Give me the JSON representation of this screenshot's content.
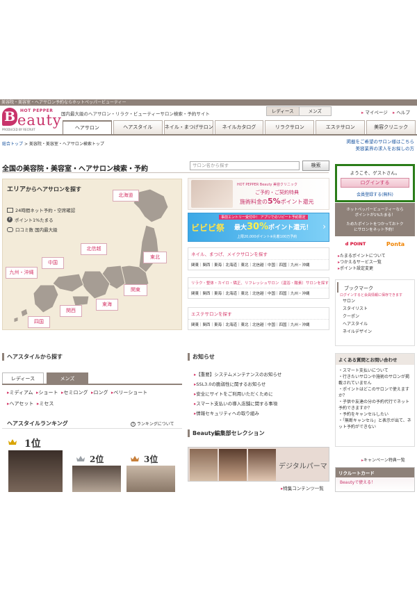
{
  "topbar": {
    "text": "美容院・美容室・ヘアサロン予約ならホットペッパービューティー"
  },
  "logo": {
    "hot_pepper": "HOT PEPPER",
    "b": "B",
    "word": "eauty",
    "by": "PRODUCED BY RECRUIT"
  },
  "header": {
    "tagline": "国内最大級のヘアサロン・リラク・ビューティーサロン検索・予約サイト",
    "gender_tabs": [
      "レディース",
      "メンズ"
    ],
    "mypage": "マイページ",
    "help": "ヘルプ"
  },
  "nav": {
    "tabs": [
      "ヘアサロン",
      "ヘアスタイル",
      "ネイル・まつげサロン",
      "ネイルカタログ",
      "リラクサロン",
      "エステサロン",
      "美容クリニック"
    ]
  },
  "breadcrumb": {
    "home": "総合トップ",
    "sep": ">",
    "current": "美容院・美容室・ヘアサロン検索トップ"
  },
  "recruit": {
    "line1": "掲載をご希望のサロン様はこちら",
    "line2": "美容業界の求人をお探しの方"
  },
  "main": {
    "title": "全国の美容院・美容室・ヘアサロン検索・予約",
    "search_placeholder": "サロン名から探す",
    "search_button": "検索"
  },
  "map": {
    "heading_area": "エリア",
    "heading_rest": "からヘアサロンを探す",
    "features": [
      "24時間ネット予約・空席確認",
      "ポイント1%たまる",
      "口コミ数 国内最大級"
    ],
    "regions": [
      "北海道",
      "東北",
      "北信越",
      "関東",
      "中国",
      "九州・沖縄",
      "関西",
      "東海",
      "四国"
    ]
  },
  "banners": {
    "clinic_brand": "HOT PEPPER Beauty 美容クリニック",
    "clinic_line1": "ご予約・ご契約特典",
    "clinic_line2a": "施術料金の",
    "clinic_percent": "5%",
    "clinic_line2b": "ポイント還元",
    "app_top": "事前エントリー受付中！ アプリでのリピート予約限定",
    "app_fes": "ビビビ祭",
    "app_mid_a": "最大",
    "app_mid_percent": "30%",
    "app_mid_b": "ポイント還元！",
    "app_bottom": "上限20,000ポイント※先着100万予約"
  },
  "categories": [
    {
      "title": "ネイル、まつげ、メイクサロンを探す",
      "links": "関東｜関西｜東海｜北海道｜東北｜北信越｜中国｜四国｜九州・沖縄"
    },
    {
      "title": "リラク・整体・カイロ・矯正、リフレッシュサロン（温浴・酸素）サロンを探す",
      "links": "関東｜関西｜東海｜北海道｜東北｜北信越｜中国｜四国｜九州・沖縄"
    },
    {
      "title": "エステサロンを探す",
      "links": "関東｜関西｜東海｜北海道｜東北｜北信越｜中国｜四国｜九州・沖縄"
    }
  ],
  "sidebar": {
    "welcome": "ようこそ、ゲストさん。",
    "login": "ログインする",
    "register": "会員登録する(無料)",
    "promo1": "ホットペッパービューティーなら",
    "promo2": "ポイントが1%たまる！",
    "promo3": "ためたポイントをつかっておトク",
    "promo4": "にサロンをネット予約！",
    "dpoint": "d POINT",
    "ponta": "Ponta",
    "links": [
      "たまるポイントについて",
      "つかえるサービス一覧",
      "ポイント設定変更"
    ],
    "bookmark_title": "ブックマーク",
    "bookmark_note": "ログインすると会員情報に保存できます",
    "bookmark_links": [
      "サロン",
      "スタイリスト",
      "クーポン",
      "ヘアスタイル",
      "ネイルデザイン"
    ],
    "faq_title": "よくある質問とお問い合わせ",
    "faq_items": [
      "スマート支払いについて",
      "行きたいサロンや施術のサロンが掲載されていません",
      "ポイントはどこのサロンで使えますか？",
      "子供や友達の分の予約代行でネット予約できますか？",
      "予約をキャンセルしたい",
      "「無断キャンセル」と表示が出て、ネット予約ができない"
    ],
    "campaign": "キャンペーン特典一覧",
    "card_title": "リクルートカード",
    "card_sub": "Beautyで使える！"
  },
  "hairstyle": {
    "heading": "ヘアスタイルから探す",
    "tabs": [
      "レディース",
      "メンズ"
    ],
    "links_row1": [
      "ミディアム",
      "ショート",
      "セミロング",
      "ロング",
      "ベリーショート"
    ],
    "links_row2": [
      "ヘアセット",
      "ミセス"
    ],
    "ranking_title": "ヘアスタイルランキング",
    "ranking_link": "ランキングについて",
    "ranks": [
      "1位",
      "2位",
      "3位"
    ]
  },
  "news": {
    "heading": "お知らせ",
    "items": [
      "【重要】システムメンテナンスのお知らせ",
      "SSL3.0の脆弱性に関するお知らせ",
      "安全にサイトをご利用いただくために",
      "スマート支払いの導入店舗に関する事項",
      "情報セキュリティへの取り組み"
    ]
  },
  "feature": {
    "heading": "Beauty編集部セレクション",
    "banner_text": "デジタルパーマ",
    "more": "特集コンテンツ一覧"
  },
  "colors": {
    "brand": "#c8336a",
    "nav": "#8e8179",
    "login_border": "#2a7c18"
  }
}
